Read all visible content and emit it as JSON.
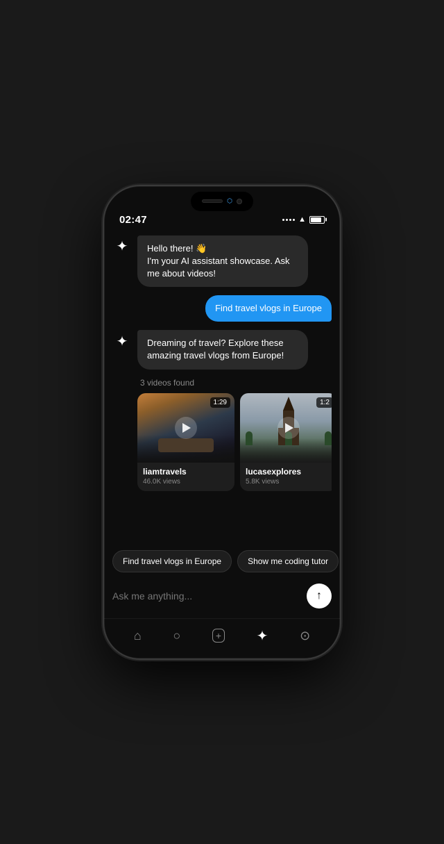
{
  "status": {
    "time": "02:47",
    "battery_level": "85%"
  },
  "chat": {
    "ai_greeting": "Hello there! 👋\nI'm your AI assistant showcase. Ask me about videos!",
    "user_message_1": "Find travel vlogs in Europe",
    "ai_response": "Dreaming of travel? Explore these amazing travel vlogs from Europe!",
    "videos_count_label": "3 videos found"
  },
  "videos": [
    {
      "channel": "liamtravels",
      "views": "46.0K views",
      "duration": "1:29",
      "scene": "bedroom"
    },
    {
      "channel": "lucasexplores",
      "views": "5.8K views",
      "duration": "1:2",
      "scene": "church"
    }
  ],
  "quick_replies": [
    "Find travel vlogs in Europe",
    "Show me coding tutor"
  ],
  "input": {
    "placeholder": "Ask me anything..."
  },
  "nav": {
    "items": [
      "home",
      "search",
      "add",
      "star",
      "profile"
    ]
  }
}
